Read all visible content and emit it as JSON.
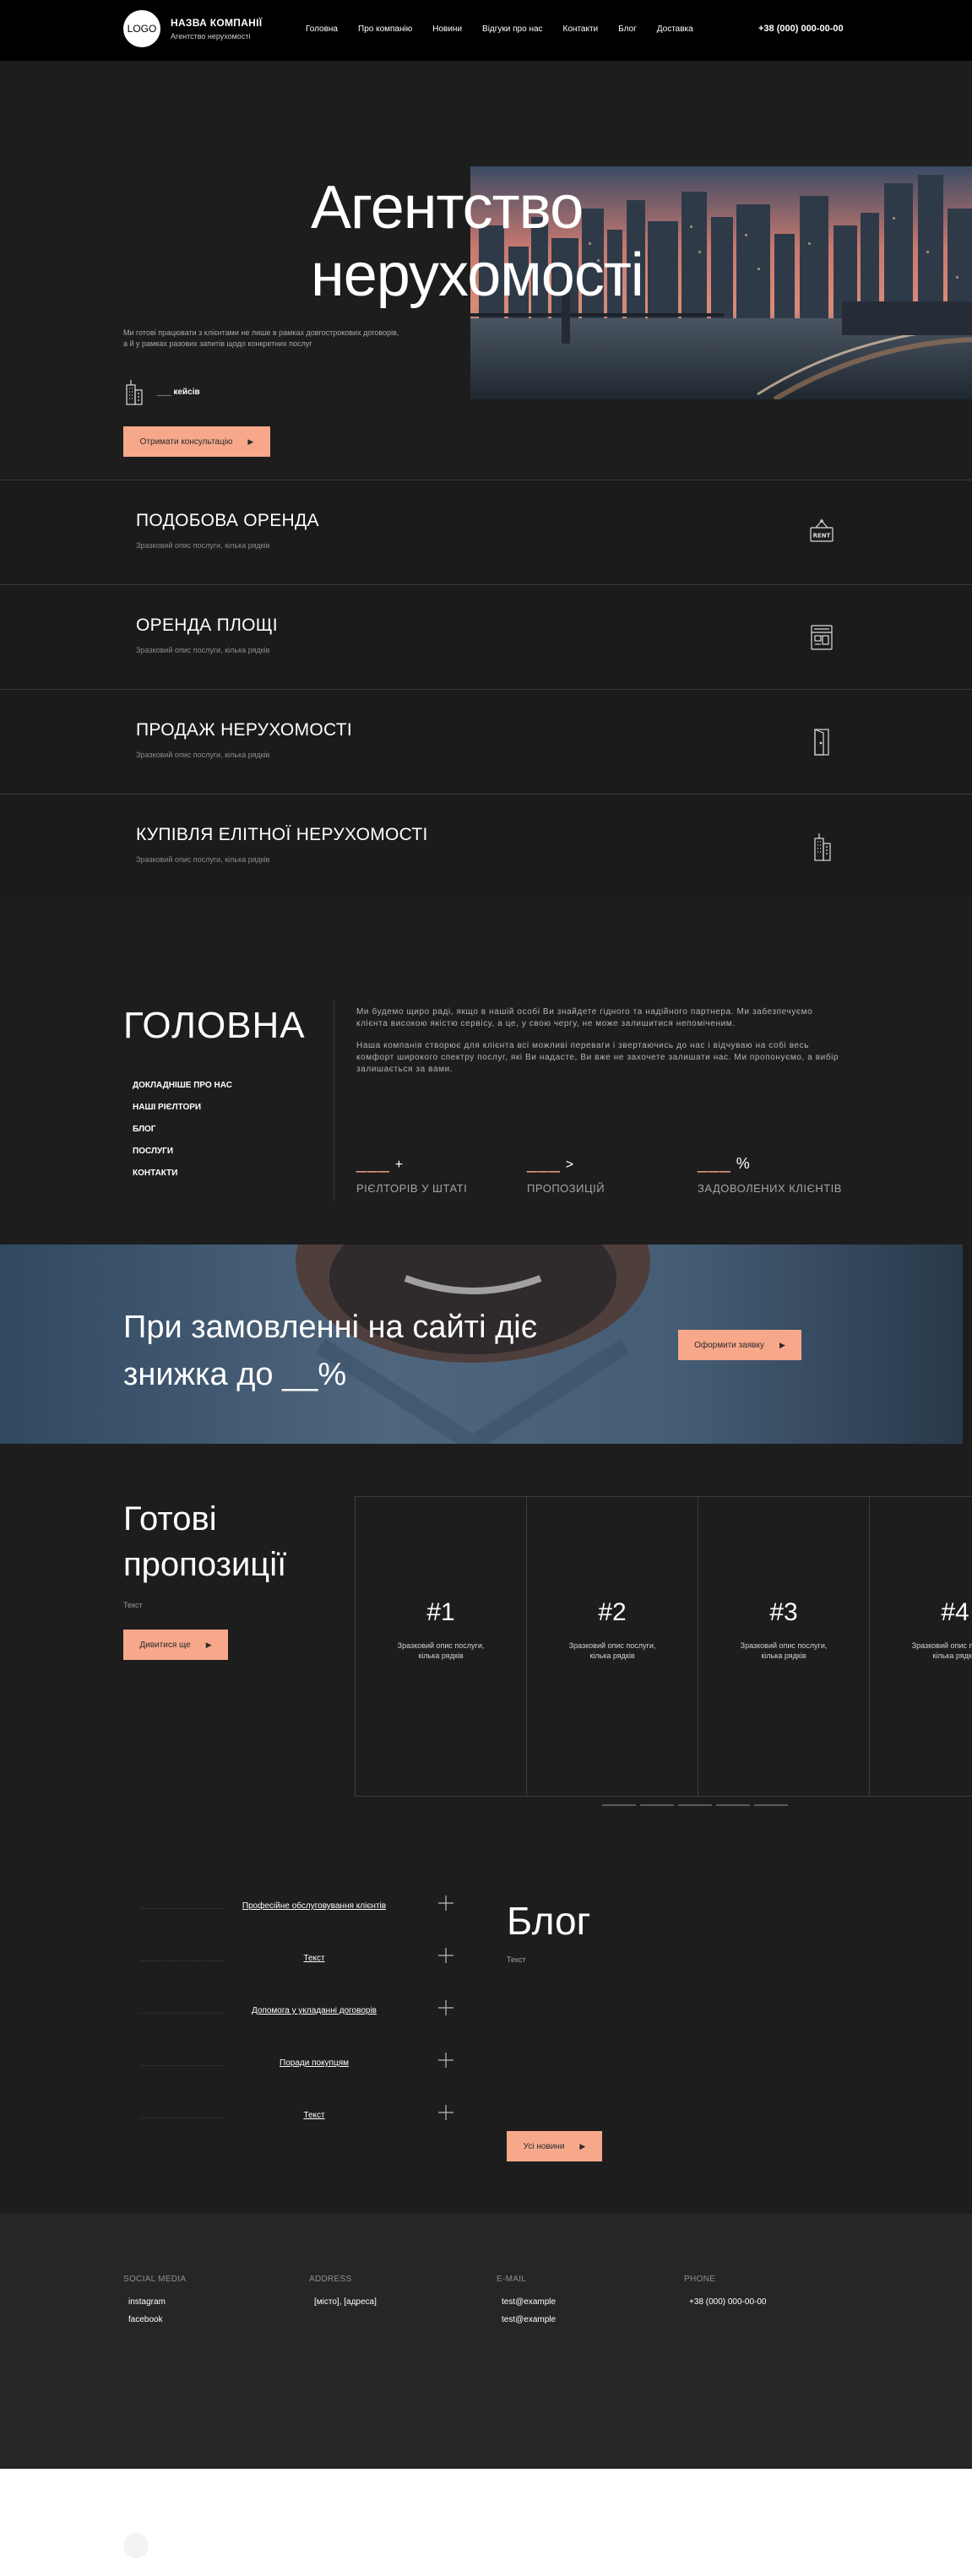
{
  "header": {
    "logo_text": "LOGO",
    "brand_name": "НАЗВА КОМПАНІЇ",
    "brand_sub": "Агентство нерухомості",
    "nav": [
      "Головна",
      "Про компанію",
      "Новини",
      "Відгуки про нас",
      "Контакти",
      "Блог",
      "Доставка"
    ],
    "phone": "+38 (000) 000-00-00"
  },
  "hero": {
    "title_line1": "Агентство",
    "title_line2": "нерухомості",
    "description": "Ми готові працювати з клієнтами не лише в рамках довгострокових договорів, а й у рамках разових запитів щодо конкретних послуг",
    "cases_label": "___ кейсів",
    "button_label": "Отримати консультацію",
    "image_alt": "city skyline"
  },
  "services": [
    {
      "title": "ПОДОБОВА ОРЕНДА",
      "desc": "Зразковий опис послуги, кілька рядків",
      "icon": "rent-sign-icon"
    },
    {
      "title": "ОРЕНДА ПЛОЩІ",
      "desc": "Зразковий опис послуги, кілька рядків",
      "icon": "shop-icon"
    },
    {
      "title": "ПРОДАЖ НЕРУХОМОСТІ",
      "desc": "Зразковий опис послуги, кілька рядків",
      "icon": "door-icon"
    },
    {
      "title": "КУПІВЛЯ ЕЛІТНОЇ НЕРУХОМОСТІ",
      "desc": "Зразковий опис послуги, кілька рядків",
      "icon": "building-icon"
    }
  ],
  "about": {
    "title": "ГОЛОВНА",
    "links": [
      "ДОКЛАДНІШЕ ПРО НАС",
      "НАШІ РІЄЛТОРИ",
      "БЛОГ",
      "ПОСЛУГИ",
      "КОНТАКТИ"
    ],
    "paragraph1": "Ми будемо щиро раді, якщо в нашій особі Ви знайдете гідного та надійного партнера. Ми забезпечуємо клієнта високою якістю сервісу, а це, у свою чергу, не може залишитися непоміченим.",
    "paragraph2": "Наша компанія створює для клієнта всі можливі переваги і звертаючись до нас і відчуваю на собі весь комфорт широкого спектру послуг, які Ви надасте, Ви вже не захочете залишати нас. Ми пропонуємо, а вибір залишається за вами.",
    "stats": [
      {
        "value": "___",
        "suffix": "+",
        "label": "РІЄЛТОРІВ У ШТАТІ"
      },
      {
        "value": "___",
        "suffix": ">",
        "label": "ПРОПОЗИЦІЙ"
      },
      {
        "value": "___",
        "suffix": "%",
        "label": "ЗАДОВОЛЕНИХ КЛІЄНТІВ"
      }
    ]
  },
  "promo": {
    "line1": "При замовленні на сайті діє",
    "line2": "знижка до __%",
    "button_label": "Оформити заявку"
  },
  "offers": {
    "title_line1": "Готові",
    "title_line2": "пропозиції",
    "sub": "Текст",
    "button_label": "Дивитися ще",
    "cards": [
      {
        "num": "#1",
        "desc": "Зразковий опис послуги, кілька рядків"
      },
      {
        "num": "#2",
        "desc": "Зразковий опис послуги, кілька рядків"
      },
      {
        "num": "#3",
        "desc": "Зразковий опис послуги, кілька рядків"
      },
      {
        "num": "#4",
        "desc": "Зразковий опис послуги, кілька рядків"
      }
    ]
  },
  "blog": {
    "faq": [
      {
        "dots": "...............................",
        "label": "Професійне обслуговування клієнтів"
      },
      {
        "dots": "...............................",
        "label": "Текст"
      },
      {
        "dots": "...............................",
        "label": "Допомога у укладанні договорів"
      },
      {
        "dots": "...............................",
        "label": "Поради покупцям"
      },
      {
        "dots": "...............................",
        "label": "Текст"
      }
    ],
    "title": "Блог",
    "sub": "Текст",
    "button_label": "Усі новини"
  },
  "footer": {
    "columns": [
      {
        "head": "SOCIAL MEDIA",
        "items": [
          "instagram",
          "facebook"
        ]
      },
      {
        "head": "ADDRESS",
        "items": [
          "[місто], [адреса]"
        ]
      },
      {
        "head": "E-MAIL",
        "items": [
          "test@example",
          "test@example"
        ]
      },
      {
        "head": "PHONE",
        "items": [
          "+38 (000) 000-00-00"
        ]
      }
    ]
  },
  "colors": {
    "accent": "#f7a88b",
    "background": "#1d1d1d",
    "header": "#000000",
    "footer": "#262626"
  }
}
